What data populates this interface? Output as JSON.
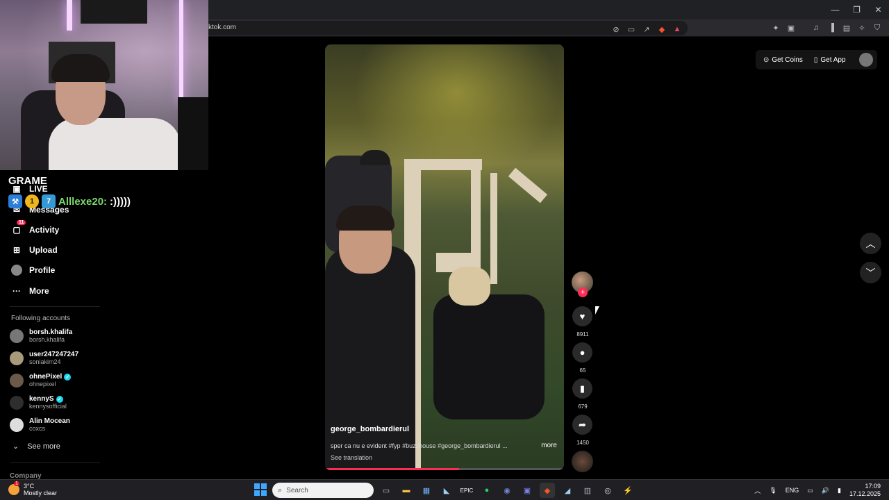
{
  "browser": {
    "url": "ktok.com",
    "window_controls": [
      "—",
      "❐",
      "✕"
    ]
  },
  "stream_overlay": {
    "channel": "GRAME",
    "chat_user": "Alllexe20:",
    "chat_message": ":)))))",
    "badge_number": "1"
  },
  "sidebar": {
    "items": [
      {
        "label": "LIVE"
      },
      {
        "label": "Messages"
      },
      {
        "label": "Activity",
        "badge": "11"
      },
      {
        "label": "Upload"
      },
      {
        "label": "Profile"
      },
      {
        "label": "More"
      }
    ],
    "following_title": "Following accounts",
    "accounts": [
      {
        "name": "borsh.khalifa",
        "handle": "borsh.khalifa"
      },
      {
        "name": "user247247247",
        "handle": "soniakim24"
      },
      {
        "name": "ohnePixel",
        "handle": "ohnepixel"
      },
      {
        "name": "kennyS",
        "handle": "kennysofficial"
      },
      {
        "name": "Alin Mocean",
        "handle": "coxcs"
      }
    ],
    "see_more": "See more",
    "company": "Company"
  },
  "video": {
    "author": "george_bombardierul",
    "description": "sper ca nu e evident #fyp #buzzhouse #george_bombardierul ...",
    "more": "more",
    "see_translation": "See translation",
    "progress_fraction": 0.56
  },
  "actions": {
    "likes": "8911",
    "comments": "65",
    "saves": "679",
    "shares": "1450"
  },
  "topright": {
    "get_coins": "Get Coins",
    "get_app": "Get App"
  },
  "taskbar": {
    "temperature": "3°C",
    "weather": "Mostly clear",
    "weather_badge": "1",
    "search_placeholder": "Search",
    "language": "ENG",
    "time": "17:09",
    "date": "17.12.2025"
  },
  "colors": {
    "accent": "#fe2c55",
    "verified": "#20d5ec"
  }
}
